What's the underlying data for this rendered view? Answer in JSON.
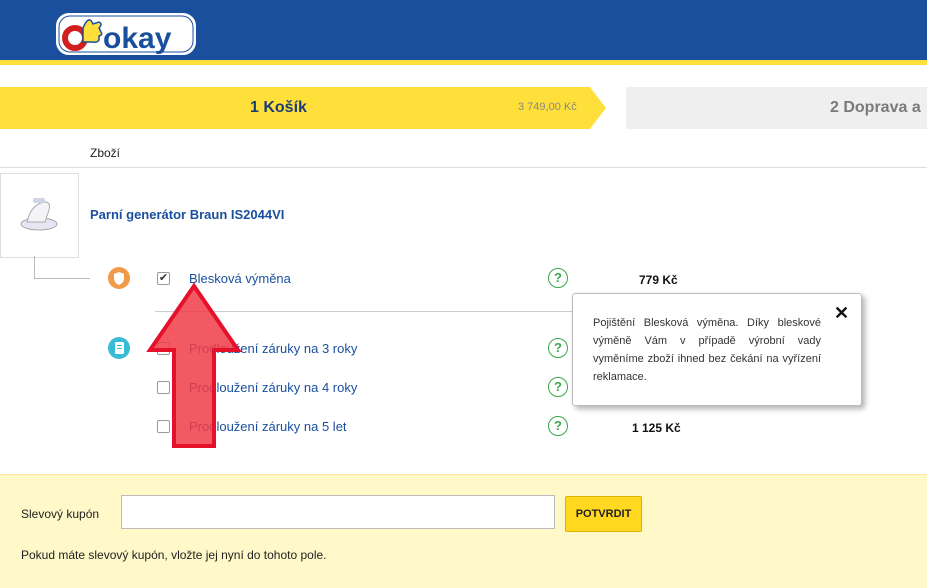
{
  "header": {
    "logo_text": "okay"
  },
  "steps": [
    {
      "label": "1 Košík",
      "amount": "3 749,00 Kč"
    },
    {
      "label": "2 Doprava a"
    }
  ],
  "cart": {
    "column_header": "Zboží",
    "product_name": "Parní generátor Braun IS2044VI"
  },
  "services": [
    {
      "label": "Blesková výměna",
      "price": "779 Kč",
      "checked": true
    },
    {
      "label": "Prodloužení záruky na 3 roky",
      "price": "",
      "checked": false
    },
    {
      "label": "Prodloužení záruky na 4 roky",
      "price": "",
      "checked": false
    },
    {
      "label": "Prodloužení záruky na 5 let",
      "price": "1 125 Kč",
      "checked": false
    }
  ],
  "help_glyph": "?",
  "tooltip": {
    "text": "Pojištění Blesková výměna. Díky bleskové výměně Vám v případě výrobní vady vyměníme zboží ihned bez čekání na vyřízení reklamace.",
    "close_glyph": "✕"
  },
  "coupon": {
    "label": "Slevový kupón",
    "input_value": "",
    "button_label": "POTVRDIT",
    "note": "Pokud máte slevový kupón, vložte jej nyní do tohoto pole."
  },
  "colors": {
    "brand_blue": "#1a4f9e",
    "accent_yellow": "#ffe03a",
    "help_green": "#3aa84a",
    "arrow_red": "#f03c46"
  }
}
